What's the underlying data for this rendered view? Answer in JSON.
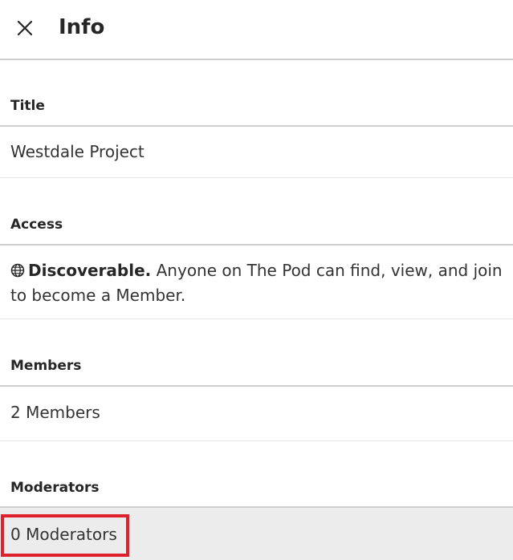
{
  "header": {
    "title": "Info",
    "close_icon": "close-icon"
  },
  "sections": {
    "title": {
      "label": "Title",
      "value": "Westdale Project"
    },
    "access": {
      "label": "Access",
      "icon": "globe-icon",
      "strong": "Discoverable.",
      "description": " Anyone on The Pod can find, view, and join to become a Member."
    },
    "members": {
      "label": "Members",
      "value": "2 Members"
    },
    "moderators": {
      "label": "Moderators",
      "value": "0 Moderators"
    }
  },
  "colors": {
    "highlight": "#e0202a",
    "selected_row_bg": "#ececec",
    "rule": "#cfcfcf"
  }
}
